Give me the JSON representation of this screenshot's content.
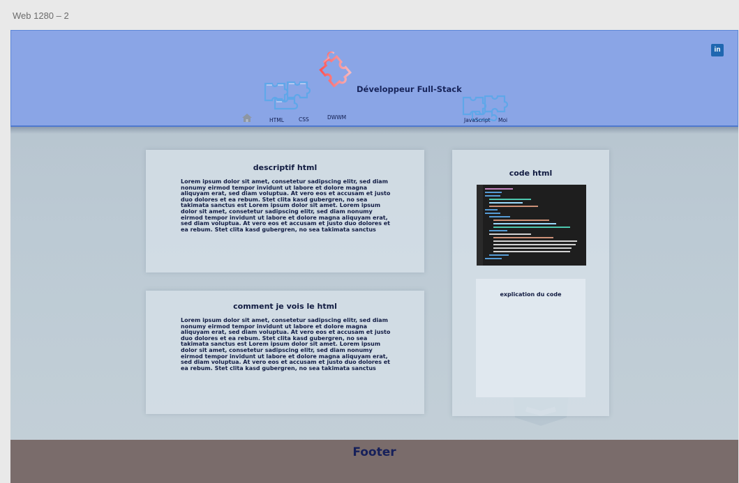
{
  "frame": {
    "title": "Web 1280 – 2"
  },
  "header": {
    "site_title": "Développeur Full-Stack",
    "linkedin_label": "in",
    "nav": {
      "html": "HTML",
      "css": "CSS",
      "dwwm": "DWWM",
      "javascript": "JavaScript",
      "moi": "Moi"
    }
  },
  "cards": {
    "descriptif": {
      "title": "descriptif html",
      "body": "Lorem ipsum dolor sit amet, consetetur sadipscing elitr, sed diam nonumy eirmod tempor invidunt ut labore et dolore magna aliquyam erat, sed diam voluptua. At vero eos et accusam et justo duo dolores et ea rebum. Stet clita kasd gubergren, no sea takimata sanctus est Lorem ipsum dolor sit amet. Lorem ipsum dolor sit amet, consetetur sadipscing elitr, sed diam nonumy eirmod tempor invidunt ut labore et dolore magna aliquyam erat, sed diam voluptua. At vero eos et accusam et justo duo dolores et ea rebum. Stet clita kasd gubergren, no sea takimata sanctus"
    },
    "comment": {
      "title": "comment je vois le html",
      "body": "Lorem ipsum dolor sit amet, consetetur sadipscing elitr, sed diam nonumy eirmod tempor invidunt ut labore et dolore magna aliquyam erat, sed diam voluptua. At vero eos et accusam et justo duo dolores et ea rebum. Stet clita kasd gubergren, no sea takimata sanctus est Lorem ipsum dolor sit amet. Lorem ipsum dolor sit amet, consetetur sadipscing elitr, sed diam nonumy eirmod tempor invidunt ut labore et dolore magna aliquyam erat, sed diam voluptua. At vero eos et accusam et justo duo dolores et ea rebum. Stet clita kasd gubergren, no sea takimata sanctus"
    },
    "code": {
      "title": "code html",
      "explain_title": "explication du code"
    }
  },
  "footer": {
    "text": "Footer"
  },
  "colors": {
    "header_bg": "#8aa5e6",
    "footer_bg": "#7a6c6b",
    "text_dark": "#121c44",
    "puzzle_red": "#e0505a",
    "puzzle_blue": "#5aa8e8"
  }
}
